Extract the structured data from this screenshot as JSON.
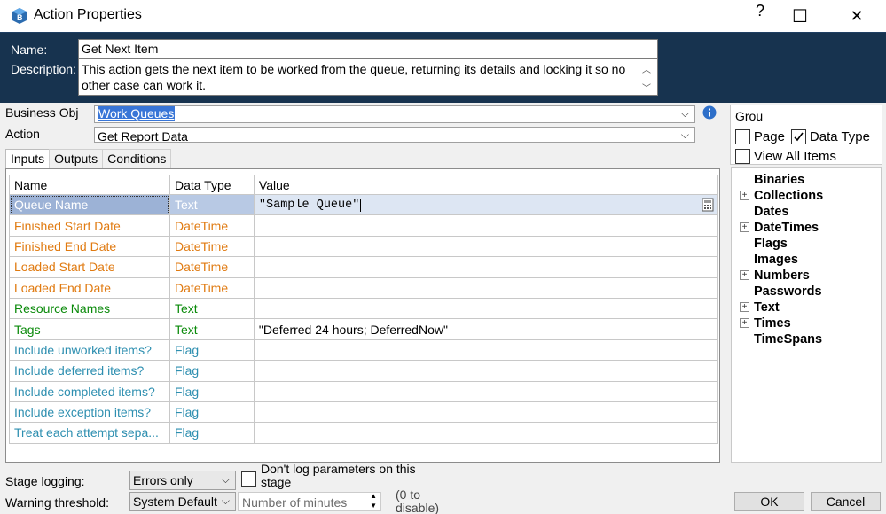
{
  "window": {
    "title": "Action Properties",
    "help_glyph": "?",
    "minimize_glyph": "—",
    "maximize_glyph": "☐",
    "close_glyph": "✕"
  },
  "header": {
    "name_label": "Name:",
    "name_value": "Get Next Item",
    "description_label": "Description:",
    "description_value": "This action gets the next item to be worked from the queue, returning its details and locking it so no other case can work it."
  },
  "business_object": {
    "label": "Business Obj",
    "value": "Work Queues"
  },
  "action": {
    "label": "Action",
    "value": "Get Report Data"
  },
  "tabs": [
    "Inputs",
    "Outputs",
    "Conditions"
  ],
  "grid": {
    "columns": [
      "Name",
      "Data Type",
      "Value"
    ],
    "rows": [
      {
        "name": "Queue Name",
        "type": "Text",
        "value": "\"Sample Queue\""
      },
      {
        "name": "Finished Start Date",
        "type": "DateTime",
        "value": ""
      },
      {
        "name": "Finished End Date",
        "type": "DateTime",
        "value": ""
      },
      {
        "name": "Loaded Start Date",
        "type": "DateTime",
        "value": ""
      },
      {
        "name": "Loaded End Date",
        "type": "DateTime",
        "value": ""
      },
      {
        "name": "Resource Names",
        "type": "Text",
        "value": ""
      },
      {
        "name": "Tags",
        "type": "Text",
        "value": "\"Deferred 24 hours; DeferredNow\""
      },
      {
        "name": "Include unworked items?",
        "type": "Flag",
        "value": ""
      },
      {
        "name": "Include deferred items?",
        "type": "Flag",
        "value": ""
      },
      {
        "name": "Include completed items?",
        "type": "Flag",
        "value": ""
      },
      {
        "name": "Include exception items?",
        "type": "Flag",
        "value": ""
      },
      {
        "name": "Treat each attempt sepa...",
        "type": "Flag",
        "value": ""
      }
    ]
  },
  "right_panel": {
    "group_label": "Grou",
    "page_label": "Page",
    "data_type_label": "Data Type",
    "view_all_label": "View All Items"
  },
  "tree": [
    {
      "label": "Binaries",
      "expandable": false
    },
    {
      "label": "Collections",
      "expandable": true
    },
    {
      "label": "Dates",
      "expandable": false
    },
    {
      "label": "DateTimes",
      "expandable": true
    },
    {
      "label": "Flags",
      "expandable": false
    },
    {
      "label": "Images",
      "expandable": false
    },
    {
      "label": "Numbers",
      "expandable": true
    },
    {
      "label": "Passwords",
      "expandable": false
    },
    {
      "label": "Text",
      "expandable": true
    },
    {
      "label": "Times",
      "expandable": true
    },
    {
      "label": "TimeSpans",
      "expandable": false
    }
  ],
  "footer": {
    "stage_logging_label": "Stage logging:",
    "stage_logging_value": "Errors only",
    "dont_log_label": "Don't log parameters on this stage",
    "warning_label": "Warning threshold:",
    "warning_value": "System Default",
    "minutes_placeholder": "Number of minutes",
    "zero_hint": "(0 to disable)",
    "ok_label": "OK",
    "cancel_label": "Cancel"
  },
  "colors": {
    "header_bg": "#17334f",
    "selection": "#9cb2d6",
    "datetime_orange": "#e07a10",
    "text_green": "#0a8a0a",
    "flag_teal": "#2e8fb0"
  }
}
